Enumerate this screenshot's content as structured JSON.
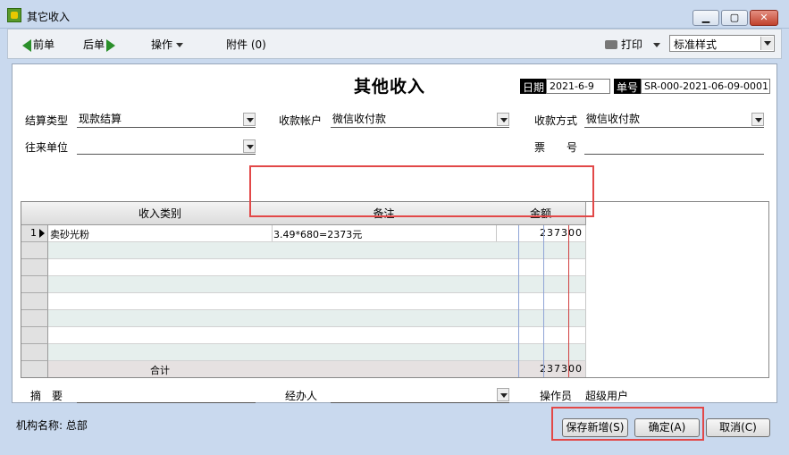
{
  "window": {
    "title": "其它收入"
  },
  "toolbar": {
    "prev_label": "前单",
    "next_label": "后单",
    "ops_label": "操作",
    "attach_label": "附件 (0)",
    "print_label": "打印",
    "template_value": "标准样式"
  },
  "form": {
    "title": "其他收入",
    "date_label": "日期",
    "date_value": "2021-6-9",
    "number_label": "单号",
    "number_value": "SR-000-2021-06-09-0001",
    "settle_type_label": "结算类型",
    "settle_type_value": "现款结算",
    "account_label": "收款帐户",
    "account_value": "微信收付款",
    "method_label": "收款方式",
    "method_value": "微信收付款",
    "partner_label": "往来单位",
    "partner_value": "",
    "ticket_label": "票　　号",
    "ticket_value": ""
  },
  "grid": {
    "headers": [
      "收入类别",
      "备注",
      "金额"
    ],
    "rows": [
      {
        "num": "1",
        "category": "卖砂光粉",
        "note": "3.49*680=2373元",
        "amount": "237300"
      }
    ],
    "total_label": "合计",
    "total_amount": "237300"
  },
  "footer": {
    "summary_label": "摘　要",
    "handler_label": "经办人",
    "operator_label": "操作员",
    "operator_value": "超级用户"
  },
  "statusbar": {
    "org_label": "机构名称: 总部"
  },
  "buttons": {
    "save_new": "保存新增(S)",
    "confirm": "确定(A)",
    "cancel": "取消(C)"
  }
}
